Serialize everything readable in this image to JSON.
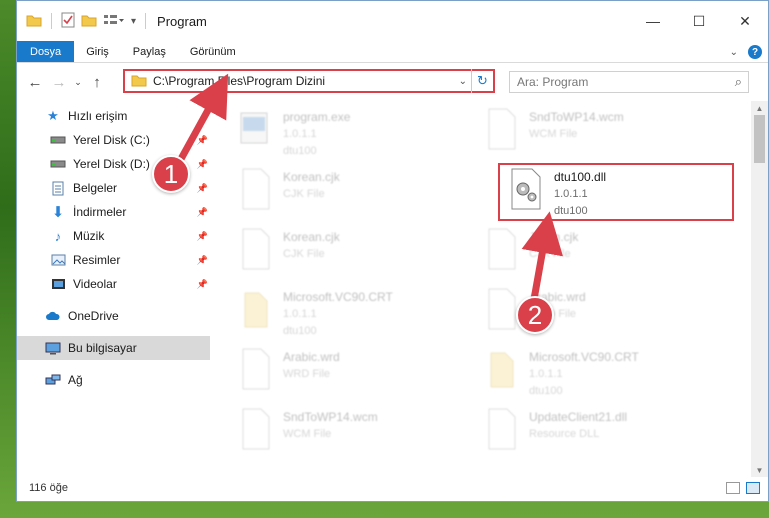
{
  "window": {
    "title": "Program",
    "controls": {
      "minimize": "—",
      "maximize": "☐",
      "close": "✕"
    }
  },
  "ribbon": {
    "tabs": [
      "Dosya",
      "Giriş",
      "Paylaş",
      "Görünüm"
    ]
  },
  "address": {
    "path": "C:\\Program Files\\Program Dizini"
  },
  "search": {
    "placeholder": "Ara: Program"
  },
  "sidebar": {
    "items": [
      {
        "label": "Hızlı erişim",
        "icon": "star-icon",
        "pinned": false
      },
      {
        "label": "Yerel Disk (C:)",
        "icon": "drive-icon",
        "pinned": true
      },
      {
        "label": "Yerel Disk (D:)",
        "icon": "drive-icon",
        "pinned": true
      },
      {
        "label": "Belgeler",
        "icon": "documents-icon",
        "pinned": true
      },
      {
        "label": "İndirmeler",
        "icon": "download-icon",
        "pinned": true
      },
      {
        "label": "Müzik",
        "icon": "music-icon",
        "pinned": true
      },
      {
        "label": "Resimler",
        "icon": "pictures-icon",
        "pinned": true
      },
      {
        "label": "Videolar",
        "icon": "video-icon",
        "pinned": true
      },
      {
        "label": "OneDrive",
        "icon": "cloud-icon",
        "pinned": false
      },
      {
        "label": "Bu bilgisayar",
        "icon": "computer-icon",
        "pinned": false
      },
      {
        "label": "Ağ",
        "icon": "network-icon",
        "pinned": false
      }
    ]
  },
  "files": {
    "left": [
      {
        "name": "program.exe",
        "line2": "1.0.1.1",
        "line3": "dtu100",
        "icon": "exe-icon"
      },
      {
        "name": "Korean.cjk",
        "line2": "CJK File",
        "line3": "",
        "icon": "file-icon"
      },
      {
        "name": "Korean.cjk",
        "line2": "CJK File",
        "line3": "",
        "icon": "file-icon"
      },
      {
        "name": "Microsoft.VC90.CRT",
        "line2": "1.0.1.1",
        "line3": "dtu100",
        "icon": "folder-icon"
      },
      {
        "name": "Arabic.wrd",
        "line2": "WRD File",
        "line3": "",
        "icon": "file-icon"
      },
      {
        "name": "SndToWP14.wcm",
        "line2": "WCM File",
        "line3": "",
        "icon": "file-icon"
      }
    ],
    "right": [
      {
        "name": "SndToWP14.wcm",
        "line2": "WCM File",
        "line3": "",
        "icon": "file-icon"
      },
      {
        "name": "dtu100.dll",
        "line2": "1.0.1.1",
        "line3": "dtu100",
        "icon": "dll-gear-icon"
      },
      {
        "name": "JKorn.cjk",
        "line2": "CJK File",
        "line3": "",
        "icon": "file-icon"
      },
      {
        "name": "Arabic.wrd",
        "line2": "WRD File",
        "line3": "",
        "icon": "file-icon"
      },
      {
        "name": "Microsoft.VC90.CRT",
        "line2": "1.0.1.1",
        "line3": "dtu100",
        "icon": "folder-icon"
      },
      {
        "name": "UpdateClient21.dll",
        "line2": "Resource DLL",
        "line3": "",
        "icon": "file-icon"
      }
    ]
  },
  "status": {
    "count": "116 öğe"
  },
  "callouts": {
    "one": "1",
    "two": "2"
  },
  "colors": {
    "accent": "#1979ca",
    "highlight": "#d9404a"
  }
}
